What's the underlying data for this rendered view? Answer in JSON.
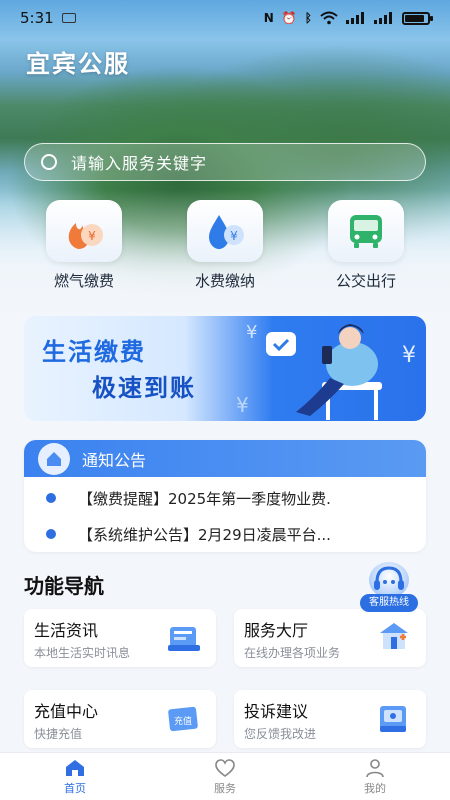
{
  "status_bar": {
    "time": "5:31",
    "icons": [
      "nfc-icon",
      "alarm-icon",
      "bluetooth-icon",
      "wifi-icon",
      "signal-icon",
      "signal-icon",
      "battery-icon"
    ],
    "battery_level": 0.85
  },
  "app": {
    "title": "宜宾公服"
  },
  "search": {
    "placeholder": "请输入服务关键字"
  },
  "quick_actions": [
    {
      "label": "燃气缴费",
      "icon": "gas-payment-icon"
    },
    {
      "label": "水费缴纳",
      "icon": "water-payment-icon"
    },
    {
      "label": "公交出行",
      "icon": "bus-icon"
    }
  ],
  "banner": {
    "line1": "生活缴费",
    "line2": "极速到账"
  },
  "notice": {
    "title": "通知公告",
    "items": [
      "【缴费提醒】2025年第一季度物业费.",
      "【系统维护公告】2月29日凌晨平台..."
    ]
  },
  "function_nav": {
    "title": "功能导航",
    "customer_service": "客服热线",
    "cards": [
      {
        "title": "生活资讯",
        "subtitle": "本地生活实时讯息",
        "icon": "news-icon"
      },
      {
        "title": "服务大厅",
        "subtitle": "在线办理各项业务",
        "icon": "service-hall-icon"
      },
      {
        "title": "充值中心",
        "subtitle": "快捷充值",
        "icon": "recharge-icon",
        "icon_text": "充值"
      },
      {
        "title": "投诉建议",
        "subtitle": "您反馈我改进",
        "icon": "complaint-icon"
      }
    ]
  },
  "tabs": [
    {
      "label": "首页",
      "icon": "home-icon",
      "active": true
    },
    {
      "label": "服务",
      "icon": "heart-icon",
      "active": false
    },
    {
      "label": "我的",
      "icon": "user-icon",
      "active": false
    }
  ],
  "colors": {
    "primary": "#2f6fe3",
    "banner_blue": "#1f6ae0"
  }
}
